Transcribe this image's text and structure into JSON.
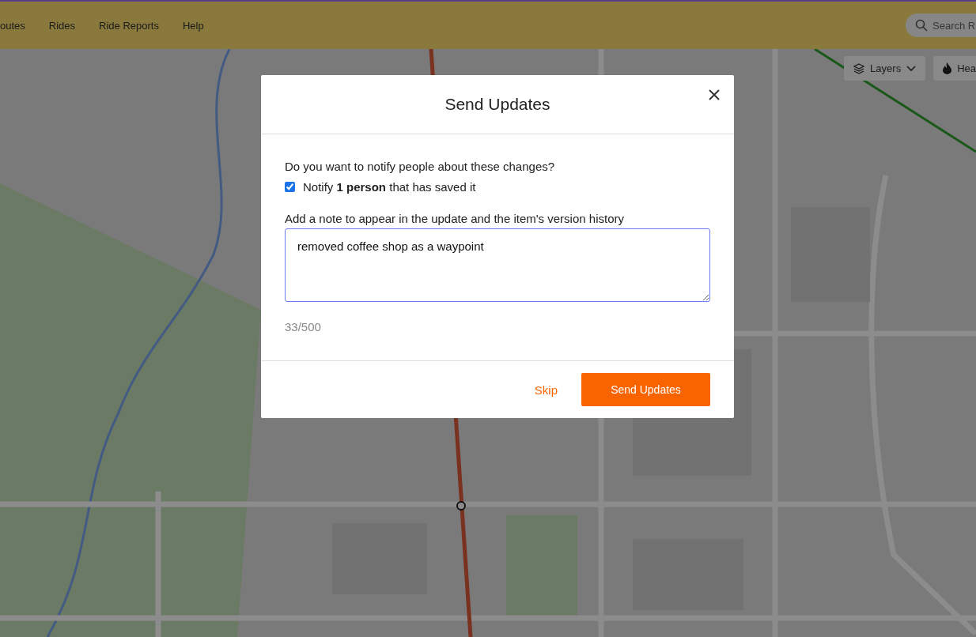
{
  "nav": {
    "items": [
      {
        "label": "outes"
      },
      {
        "label": "Rides"
      },
      {
        "label": "Ride Reports"
      },
      {
        "label": "Help"
      }
    ]
  },
  "search": {
    "placeholder": "Search R"
  },
  "map_controls": [
    {
      "label": "Layers",
      "kind": "layers"
    },
    {
      "label": "Hea",
      "kind": "heatmap"
    }
  ],
  "dialog": {
    "title": "Send Updates",
    "question": "Do you want to notify people about these changes?",
    "notify": {
      "label": "Notify **1 person** that has saved it",
      "checked": true
    },
    "note_label": "Add a note to appear in the update and the item's version history",
    "note": {
      "value": "removed coffee shop as a waypoint"
    },
    "counter": "33/500",
    "buttons": [
      {
        "label": "Skip",
        "kind": "link"
      },
      {
        "label": "Send Updates",
        "kind": "primary"
      }
    ]
  }
}
